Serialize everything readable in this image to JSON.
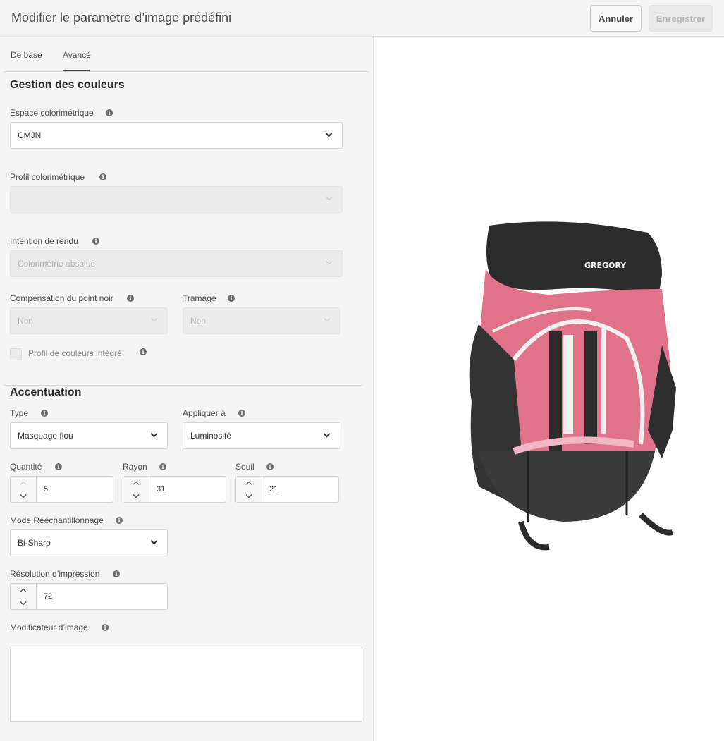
{
  "header": {
    "title": "Modifier le paramètre d’image prédéfini",
    "cancel_label": "Annuler",
    "save_label": "Enregistrer"
  },
  "tabs": [
    {
      "label": "De base",
      "active": false
    },
    {
      "label": "Avancé",
      "active": true
    }
  ],
  "color_management": {
    "heading": "Gestion des couleurs",
    "color_space": {
      "label": "Espace colorimétrique",
      "value": "CMJN"
    },
    "color_profile": {
      "label": "Profil colorimétrique",
      "value": ""
    },
    "rendering_intent": {
      "label": "Intention de rendu",
      "value": "Colorimétrie absolue"
    },
    "black_point": {
      "label": "Compensation du point noir",
      "value": "Non"
    },
    "dithering": {
      "label": "Tramage",
      "value": "Non"
    },
    "embedded_profile": {
      "label": "Profil de couleurs intégré",
      "checked": false
    }
  },
  "sharpening": {
    "heading": "Accentuation",
    "type": {
      "label": "Type",
      "value": "Masquage flou"
    },
    "apply_to": {
      "label": "Appliquer à",
      "value": "Luminosité"
    },
    "amount": {
      "label": "Quantité",
      "value": "5"
    },
    "radius": {
      "label": "Rayon",
      "value": "31"
    },
    "threshold": {
      "label": "Seuil",
      "value": "21"
    },
    "resampling": {
      "label": "Mode Rééchantillonnage",
      "value": "Bi-Sharp"
    },
    "print_resolution": {
      "label": "Résolution d’impression",
      "value": "72"
    },
    "image_modifier": {
      "label": "Modificateur d’image",
      "value": ""
    }
  },
  "preview": {
    "logo_text": "GREGORY",
    "colors": {
      "accent_pink": "#e07389",
      "dark": "#2b2b2b",
      "strap_white": "#f0f0f0"
    }
  },
  "icons": {
    "info": "info-icon",
    "chevron": "chevron-down-icon",
    "up": "chevron-up-icon"
  }
}
